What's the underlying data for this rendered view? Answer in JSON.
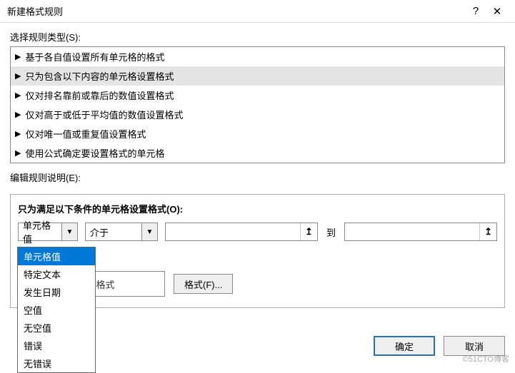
{
  "titlebar": {
    "title": "新建格式规则",
    "help": "?",
    "close": "✕"
  },
  "labels": {
    "selectType": "选择规则类型(S):",
    "editDesc": "编辑规则说明(E):",
    "panelTitle": "只为满足以下条件的单元格设置格式(O):",
    "to": "到",
    "previewPrefix": "",
    "noFormat": "未设定格式",
    "formatBtn": "格式(F)...",
    "chooseIcon": "↥"
  },
  "ruleTypes": [
    {
      "label": "基于各自值设置所有单元格的格式",
      "selected": false
    },
    {
      "label": "只为包含以下内容的单元格设置格式",
      "selected": true
    },
    {
      "label": "仅对排名靠前或靠后的数值设置格式",
      "selected": false
    },
    {
      "label": "仅对高于或低于平均值的数值设置格式",
      "selected": false
    },
    {
      "label": "仅对唯一值或重复值设置格式",
      "selected": false
    },
    {
      "label": "使用公式确定要设置格式的单元格",
      "selected": false
    }
  ],
  "condition": {
    "value": "单元格值"
  },
  "operator": {
    "value": "介于"
  },
  "lowValue": "",
  "highValue": "",
  "conditionOptions": [
    {
      "label": "单元格值",
      "selected": true
    },
    {
      "label": "特定文本",
      "selected": false
    },
    {
      "label": "发生日期",
      "selected": false
    },
    {
      "label": "空值",
      "selected": false
    },
    {
      "label": "无空值",
      "selected": false
    },
    {
      "label": "错误",
      "selected": false
    },
    {
      "label": "无错误",
      "selected": false
    }
  ],
  "footer": {
    "ok": "确定",
    "cancel": "取消"
  },
  "watermark": "©51CTO博客"
}
